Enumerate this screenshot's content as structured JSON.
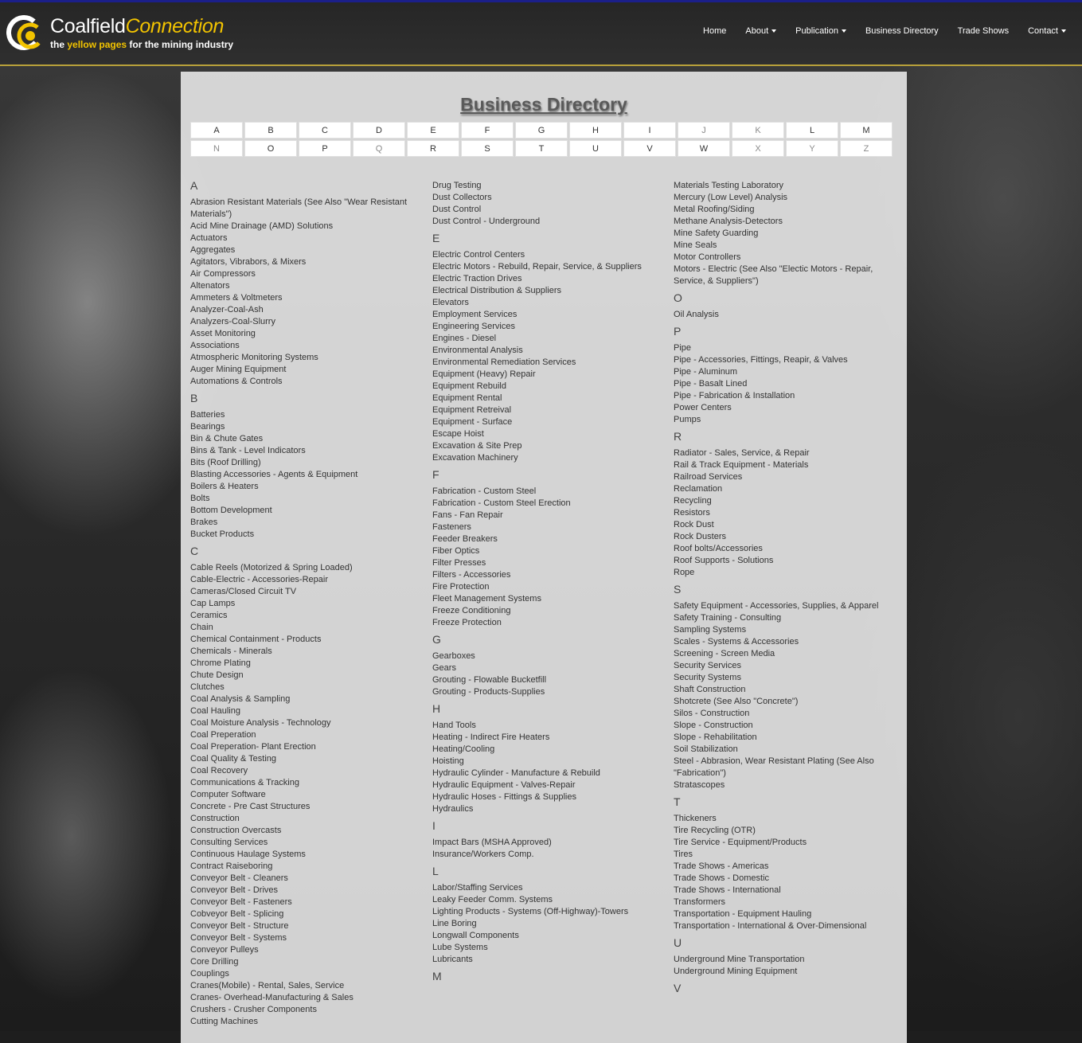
{
  "logo": {
    "title_a": "Coalfield",
    "title_b": "Connection",
    "tag_a": "the ",
    "tag_b": "yellow pages",
    "tag_c": " for the mining industry"
  },
  "nav": [
    "Home",
    "About",
    "Publication",
    "Business Directory",
    "Trade Shows",
    "Contact"
  ],
  "page_title": "Business Directory",
  "alphabet": {
    "row1": [
      {
        "l": "A",
        "on": true
      },
      {
        "l": "B",
        "on": true
      },
      {
        "l": "C",
        "on": true
      },
      {
        "l": "D",
        "on": true
      },
      {
        "l": "E",
        "on": true
      },
      {
        "l": "F",
        "on": true
      },
      {
        "l": "G",
        "on": true
      },
      {
        "l": "H",
        "on": true
      },
      {
        "l": "I",
        "on": true
      },
      {
        "l": "J",
        "on": false
      },
      {
        "l": "K",
        "on": false
      },
      {
        "l": "L",
        "on": true
      },
      {
        "l": "M",
        "on": true
      }
    ],
    "row2": [
      {
        "l": "N",
        "on": false
      },
      {
        "l": "O",
        "on": true
      },
      {
        "l": "P",
        "on": true
      },
      {
        "l": "Q",
        "on": false
      },
      {
        "l": "R",
        "on": true
      },
      {
        "l": "S",
        "on": true
      },
      {
        "l": "T",
        "on": true
      },
      {
        "l": "U",
        "on": true
      },
      {
        "l": "V",
        "on": true
      },
      {
        "l": "W",
        "on": true
      },
      {
        "l": "X",
        "on": false
      },
      {
        "l": "Y",
        "on": false
      },
      {
        "l": "Z",
        "on": false
      }
    ]
  },
  "columns": [
    [
      {
        "letter": "A",
        "items": [
          "Abrasion Resistant Materials (See Also \"Wear Resistant Materials\")",
          "Acid Mine Drainage (AMD) Solutions",
          "Actuators",
          "Aggregates",
          "Agitators, Vibrabors, & Mixers",
          "Air Compressors",
          "Altenators",
          "Ammeters & Voltmeters",
          "Analyzer-Coal-Ash",
          "Analyzers-Coal-Slurry",
          "Asset Monitoring",
          "Associations",
          "Atmospheric Monitoring Systems",
          "Auger Mining Equipment",
          "Automations & Controls"
        ]
      },
      {
        "letter": "B",
        "items": [
          "Batteries",
          "Bearings",
          "Bin & Chute Gates",
          "Bins & Tank - Level Indicators",
          "Bits (Roof Drilling)",
          "Blasting Accessories - Agents & Equipment",
          "Boilers & Heaters",
          "Bolts",
          "Bottom Development",
          "Brakes",
          "Bucket Products"
        ]
      },
      {
        "letter": "C",
        "items": [
          "Cable Reels (Motorized & Spring Loaded)",
          "Cable-Electric - Accessories-Repair",
          "Cameras/Closed Circuit TV",
          "Cap Lamps",
          "Ceramics",
          "Chain",
          "Chemical Containment - Products",
          "Chemicals - Minerals",
          "Chrome Plating",
          "Chute Design",
          "Clutches",
          "Coal Analysis & Sampling",
          "Coal Hauling",
          "Coal Moisture Analysis - Technology",
          "Coal Preperation",
          "Coal Preperation- Plant Erection",
          "Coal Quality & Testing",
          "Coal Recovery",
          "Communications & Tracking",
          "Computer Software",
          "Concrete - Pre Cast Structures",
          "Construction",
          "Construction Overcasts",
          "Consulting Services",
          "Continuous Haulage Systems",
          "Contract Raiseboring",
          "Conveyor Belt - Cleaners",
          "Conveyor Belt - Drives",
          "Conveyor Belt - Fasteners",
          "Cobveyor Belt - Splicing",
          "Conveyor Belt - Structure",
          "Conveyor Belt - Systems",
          "Conveyor Pulleys",
          "Core Drilling",
          "Couplings",
          "Cranes(Mobile) - Rental, Sales, Service",
          "Cranes- Overhead-Manufacturing & Sales",
          "Crushers - Crusher Components",
          "Cutting Machines"
        ]
      }
    ],
    [
      {
        "letter": "D",
        "items": [
          "Drug Testing",
          "Dust Collectors",
          "Dust Control",
          "Dust Control - Underground"
        ]
      },
      {
        "letter": "E",
        "items": [
          "Electric Control Centers",
          "Electric Motors - Rebuild, Repair, Service, & Suppliers",
          "Electric Traction Drives",
          "Electrical Distribution & Suppliers",
          "Elevators",
          "Employment Services",
          "Engineering Services",
          "Engines - Diesel",
          "Environmental Analysis",
          "Environmental Remediation Services",
          "Equipment (Heavy) Repair",
          "Equipment Rebuild",
          "Equipment Rental",
          "Equipment Retreival",
          "Equipment - Surface",
          "Escape Hoist",
          "Excavation & Site Prep",
          "Excavation Machinery"
        ]
      },
      {
        "letter": "F",
        "items": [
          "Fabrication - Custom Steel",
          "Fabrication - Custom Steel Erection",
          "Fans - Fan Repair",
          "Fasteners",
          "Feeder Breakers",
          "Fiber Optics",
          "Filter Presses",
          "Filters - Accessories",
          "Fire Protection",
          "Fleet Management Systems",
          "Freeze Conditioning",
          "Freeze Protection"
        ]
      },
      {
        "letter": "G",
        "items": [
          "Gearboxes",
          "Gears",
          "Grouting - Flowable Bucketfill",
          "Grouting - Products-Supplies"
        ]
      },
      {
        "letter": "H",
        "items": [
          "Hand Tools",
          "Heating - Indirect Fire Heaters",
          "Heating/Cooling",
          "Hoisting",
          "Hydraulic Cylinder - Manufacture & Rebuild",
          "Hydraulic Equipment - Valves-Repair",
          "Hydraulic Hoses - Fittings & Supplies",
          "Hydraulics"
        ]
      },
      {
        "letter": "I",
        "items": [
          "Impact Bars (MSHA Approved)",
          "Insurance/Workers Comp."
        ]
      },
      {
        "letter": "L",
        "items": [
          "Labor/Staffing Services",
          "Leaky Feeder Comm. Systems",
          "Lighting Products - Systems (Off-Highway)-Towers",
          "Line Boring",
          "Longwall Components",
          "Lube Systems",
          "Lubricants"
        ]
      },
      {
        "letter": "M",
        "items": []
      }
    ],
    [
      {
        "letter": "M",
        "items": [
          "Materials Testing Laboratory",
          "Mercury (Low Level) Analysis",
          "Metal Roofing/Siding",
          "Methane Analysis-Detectors",
          "Mine Safety Guarding",
          "Mine Seals",
          "Motor Controllers",
          "Motors - Electric (See Also \"Electic Motors - Repair, Service, & Suppliers\")"
        ]
      },
      {
        "letter": "O",
        "items": [
          "Oil Analysis"
        ]
      },
      {
        "letter": "P",
        "items": [
          "Pipe",
          "Pipe - Accessories, Fittings, Reapir, & Valves",
          "Pipe - Aluminum",
          "Pipe - Basalt Lined",
          "Pipe - Fabrication & Installation",
          "Power Centers",
          "Pumps"
        ]
      },
      {
        "letter": "R",
        "items": [
          "Radiator - Sales, Service, & Repair",
          "Rail & Track Equipment - Materials",
          "Railroad Services",
          "Reclamation",
          "Recycling",
          "Resistors",
          "Rock Dust",
          "Rock Dusters",
          "Roof bolts/Accessories",
          "Roof Supports - Solutions",
          "Rope"
        ]
      },
      {
        "letter": "S",
        "items": [
          "Safety Equipment - Accessories, Supplies, & Apparel",
          "Safety Training - Consulting",
          "Sampling Systems",
          "Scales - Systems & Accessories",
          "Screening - Screen Media",
          "Security Services",
          "Security Systems",
          "Shaft Construction",
          "Shotcrete (See Also \"Concrete\")",
          "Silos - Construction",
          "Slope - Construction",
          "Slope - Rehabilitation",
          "Soil Stabilization",
          "Steel - Abbrasion, Wear Resistant Plating (See Also \"Fabrication\")",
          "Stratascopes"
        ]
      },
      {
        "letter": "T",
        "items": [
          "Thickeners",
          "Tire Recycling (OTR)",
          "Tire Service - Equipment/Products",
          "Tires",
          "Trade Shows - Americas",
          "Trade Shows - Domestic",
          "Trade Shows - International",
          "Transformers",
          "Transportation - Equipment Hauling",
          "Transportation - International & Over-Dimensional"
        ]
      },
      {
        "letter": "U",
        "items": [
          "Underground Mine Transportation",
          "Underground Mining Equipment"
        ]
      },
      {
        "letter": "V",
        "items": []
      }
    ]
  ]
}
